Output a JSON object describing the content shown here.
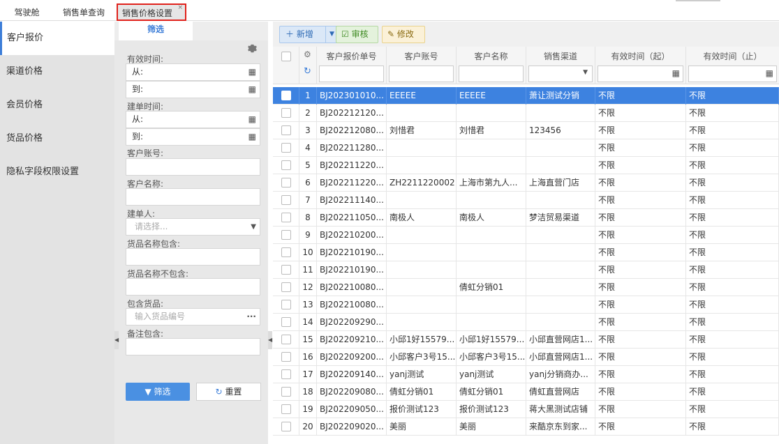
{
  "tabs": [
    {
      "label": "驾驶舱"
    },
    {
      "label": "销售单查询"
    },
    {
      "label": "销售价格设置",
      "close": "×"
    }
  ],
  "sidebar": {
    "items": [
      {
        "label": "客户报价"
      },
      {
        "label": "渠道价格"
      },
      {
        "label": "会员价格"
      },
      {
        "label": "货品价格"
      },
      {
        "label": "隐私字段权限设置"
      }
    ]
  },
  "filter": {
    "tab_label": "筛选",
    "valid_time_label": "有效时间:",
    "from_label": "从:",
    "to_label": "到:",
    "create_time_label": "建单时间:",
    "customer_account_label": "客户账号:",
    "customer_name_label": "客户名称:",
    "creator_label": "建单人:",
    "creator_placeholder": "请选择...",
    "goods_include_label": "货品名称包含:",
    "goods_exclude_label": "货品名称不包含:",
    "contain_goods_label": "包含货品:",
    "contain_goods_placeholder": "输入货品编号",
    "contain_goods_more": "...",
    "remark_label": "备注包含:",
    "filter_button": "筛选",
    "reset_button": "重置"
  },
  "toolbar": {
    "add_label": "新增",
    "audit_label": "审核",
    "edit_label": "修改"
  },
  "table": {
    "columns": [
      "客户报价单号",
      "客户账号",
      "客户名称",
      "销售渠道",
      "有效时间（起）",
      "有效时间（止）"
    ],
    "rows": [
      {
        "n": "1",
        "id": "BJ202301010...",
        "account": "EEEEE",
        "name": "EEEEE",
        "channel": "萧让测试分销",
        "start": "不限",
        "end": "不限"
      },
      {
        "n": "2",
        "id": "BJ202212120...",
        "account": "",
        "name": "",
        "channel": "",
        "start": "不限",
        "end": "不限"
      },
      {
        "n": "3",
        "id": "BJ202212080...",
        "account": "刘惜君",
        "name": "刘惜君",
        "channel": "123456",
        "start": "不限",
        "end": "不限"
      },
      {
        "n": "4",
        "id": "BJ202211280...",
        "account": "",
        "name": "",
        "channel": "",
        "start": "不限",
        "end": "不限"
      },
      {
        "n": "5",
        "id": "BJ202211220...",
        "account": "",
        "name": "",
        "channel": "",
        "start": "不限",
        "end": "不限"
      },
      {
        "n": "6",
        "id": "BJ202211220...",
        "account": "ZH2211220002",
        "name": "上海市第九人...",
        "channel": "上海直营门店",
        "start": "不限",
        "end": "不限"
      },
      {
        "n": "7",
        "id": "BJ202211140...",
        "account": "",
        "name": "",
        "channel": "",
        "start": "不限",
        "end": "不限"
      },
      {
        "n": "8",
        "id": "BJ202211050...",
        "account": "南极人",
        "name": "南极人",
        "channel": "梦洁贸易渠道",
        "start": "不限",
        "end": "不限"
      },
      {
        "n": "9",
        "id": "BJ202210200...",
        "account": "",
        "name": "",
        "channel": "",
        "start": "不限",
        "end": "不限"
      },
      {
        "n": "10",
        "id": "BJ202210190...",
        "account": "",
        "name": "",
        "channel": "",
        "start": "不限",
        "end": "不限"
      },
      {
        "n": "11",
        "id": "BJ202210190...",
        "account": "",
        "name": "",
        "channel": "",
        "start": "不限",
        "end": "不限"
      },
      {
        "n": "12",
        "id": "BJ202210080...",
        "account": "",
        "name": "倩虹分销01",
        "channel": "",
        "start": "不限",
        "end": "不限"
      },
      {
        "n": "13",
        "id": "BJ202210080...",
        "account": "",
        "name": "",
        "channel": "",
        "start": "不限",
        "end": "不限"
      },
      {
        "n": "14",
        "id": "BJ202209290...",
        "account": "",
        "name": "",
        "channel": "",
        "start": "不限",
        "end": "不限"
      },
      {
        "n": "15",
        "id": "BJ202209210...",
        "account": "小邱1好15579...",
        "name": "小邱1好15579...",
        "channel": "小邱直营网店1...",
        "start": "不限",
        "end": "不限"
      },
      {
        "n": "16",
        "id": "BJ202209200...",
        "account": "小邱客户3号15...",
        "name": "小邱客户3号15...",
        "channel": "小邱直营网店1...",
        "start": "不限",
        "end": "不限"
      },
      {
        "n": "17",
        "id": "BJ202209140...",
        "account": "yanj测试",
        "name": "yanj测试",
        "channel": "yanj分销商办...",
        "start": "不限",
        "end": "不限"
      },
      {
        "n": "18",
        "id": "BJ202209080...",
        "account": "倩虹分销01",
        "name": "倩虹分销01",
        "channel": "倩虹直营网店",
        "start": "不限",
        "end": "不限"
      },
      {
        "n": "19",
        "id": "BJ202209050...",
        "account": "报价测试123",
        "name": "报价测试123",
        "channel": "蒋大黑测试店铺",
        "start": "不限",
        "end": "不限"
      },
      {
        "n": "20",
        "id": "BJ202209020...",
        "account": "美丽",
        "name": "美丽",
        "channel": "来酷京东到家...",
        "start": "不限",
        "end": "不限"
      }
    ]
  },
  "colors": {
    "accent": "#3d7ed8",
    "selected_row": "#3d82e0",
    "highlight_border": "#e0211b"
  }
}
